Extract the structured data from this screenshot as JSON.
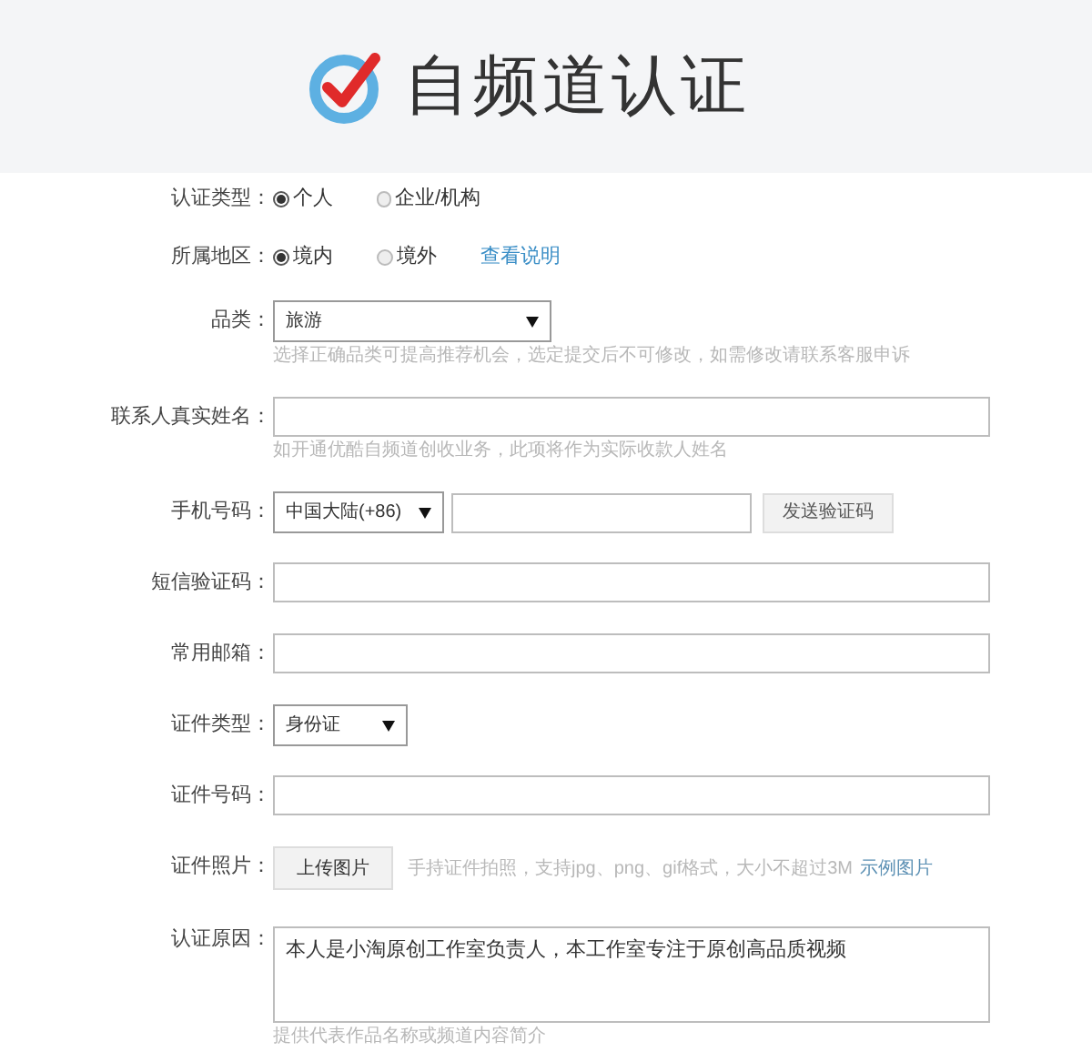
{
  "header": {
    "title": "自频道认证"
  },
  "fields": [
    {
      "kind": "radio",
      "label": "认证类型：",
      "options": [
        {
          "label": "个人",
          "selected": true
        },
        {
          "label": "企业/机构",
          "selected": false
        }
      ]
    },
    {
      "kind": "radio",
      "label": "所属地区：",
      "options": [
        {
          "label": "境内",
          "selected": true
        },
        {
          "label": "境外",
          "selected": false
        }
      ],
      "link": "查看说明"
    },
    {
      "kind": "select",
      "label": "品类：",
      "value": "旅游",
      "hint": "选择正确品类可提高推荐机会，选定提交后不可修改，如需修改请联系客服申诉"
    },
    {
      "kind": "text",
      "label": "联系人真实姓名：",
      "hint": "如开通优酷自频道创收业务，此项将作为实际收款人姓名"
    },
    {
      "kind": "phone",
      "label": "手机号码：",
      "value": "中国大陆(+86)",
      "button": "发送验证码"
    },
    {
      "kind": "text",
      "label": "短信验证码："
    },
    {
      "kind": "text",
      "label": "常用邮箱："
    },
    {
      "kind": "select_short",
      "label": "证件类型：",
      "value": "身份证"
    },
    {
      "kind": "text",
      "label": "证件号码："
    },
    {
      "kind": "upload",
      "label": "证件照片：",
      "button": "上传图片",
      "note": "手持证件拍照，支持jpg、png、gif格式，大小不超过3M",
      "link": "示例图片"
    },
    {
      "kind": "textarea",
      "label": "认证原因：",
      "value": "本人是小淘原创工作室负责人，本工作室专注于原创高品质视频",
      "hint": "提供代表作品名称或频道内容简介"
    }
  ]
}
